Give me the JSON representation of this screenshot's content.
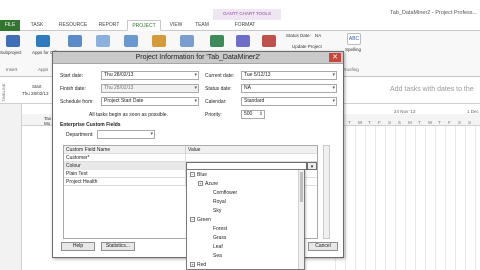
{
  "window": {
    "context_group": "GANTT CHART TOOLS",
    "title": "Tab_DataMiner2 - Project Profess..."
  },
  "ribbon": {
    "tabs": [
      "FILE",
      "TASK",
      "RESOURCE",
      "REPORT",
      "PROJECT",
      "VIEW",
      "TEAM",
      "FORMAT"
    ],
    "active_tab": "PROJECT",
    "left_buttons": [
      {
        "label": "Subproject"
      },
      {
        "label": "Apps for Office"
      },
      {
        "label": "Insert"
      },
      {
        "label": "Apps"
      }
    ],
    "status_date_label": "Status Date:",
    "status_date_value": "NA",
    "update_project_label": "Update Project",
    "spelling_label": "Spelling",
    "proofing_label": "Proofing",
    "colors": {
      "file_tab": "#31752f",
      "active_tab_text": "#31752f"
    }
  },
  "background": {
    "timeline_label": "TIMELINE",
    "start_label": "Start",
    "start_date": "Thu 28/02/13",
    "add_tasks_text": "Add tasks with dates to the",
    "week_header": "24 Nov '13",
    "week_header_2": "1 Dec",
    "column_partial": "Tas",
    "column_partial_2": "Mo",
    "day_letters": [
      "M",
      "T",
      "W",
      "T",
      "F",
      "S",
      "S",
      "M",
      "T",
      "W",
      "T",
      "F",
      "S",
      "S"
    ]
  },
  "dialog": {
    "title": "Project Information for 'Tab_DataMiner2'",
    "close_glyph": "✕",
    "start_date_label": "Start date:",
    "start_date_value": "Thu 28/02/13",
    "finish_date_label": "Finish date:",
    "finish_date_value": "Thu 28/02/13",
    "schedule_from_label": "Schedule from:",
    "schedule_from_value": "Project Start Date",
    "schedule_note": "All tasks begin as soon as possible.",
    "current_date_label": "Current date:",
    "current_date_value": "Tue 5/12/13",
    "status_date_label": "Status date:",
    "status_date_value": "NA",
    "calendar_label": "Calendar:",
    "calendar_value": "Standard",
    "priority_label": "Priority:",
    "priority_value": "500",
    "enterprise_label": "Enterprise Custom Fields",
    "department_label": "Department:",
    "table": {
      "headers": [
        "Custom Field Name",
        "Value"
      ],
      "rows": [
        {
          "name": "Customer*",
          "value": ""
        },
        {
          "name": "Colour",
          "value": ""
        },
        {
          "name": "Plain Text",
          "value": ""
        },
        {
          "name": "Project Health",
          "value": ""
        }
      ]
    },
    "help_button": "Help",
    "statistics_button": "Statistics...",
    "ok_button": "OK",
    "cancel_button": "Cancel"
  },
  "dropdown_tree": [
    {
      "label": "Blue",
      "level": 0,
      "toggle": "−"
    },
    {
      "label": "Azure",
      "level": 1,
      "toggle": "+"
    },
    {
      "label": "Cornflower",
      "level": 2,
      "toggle": ""
    },
    {
      "label": "Royal",
      "level": 2,
      "toggle": ""
    },
    {
      "label": "Sky",
      "level": 2,
      "toggle": ""
    },
    {
      "label": "Green",
      "level": 0,
      "toggle": "−"
    },
    {
      "label": "Forest",
      "level": 2,
      "toggle": ""
    },
    {
      "label": "Grass",
      "level": 2,
      "toggle": ""
    },
    {
      "label": "Leaf",
      "level": 2,
      "toggle": ""
    },
    {
      "label": "Sea",
      "level": 2,
      "toggle": ""
    },
    {
      "label": "Red",
      "level": 0,
      "toggle": "+"
    }
  ]
}
